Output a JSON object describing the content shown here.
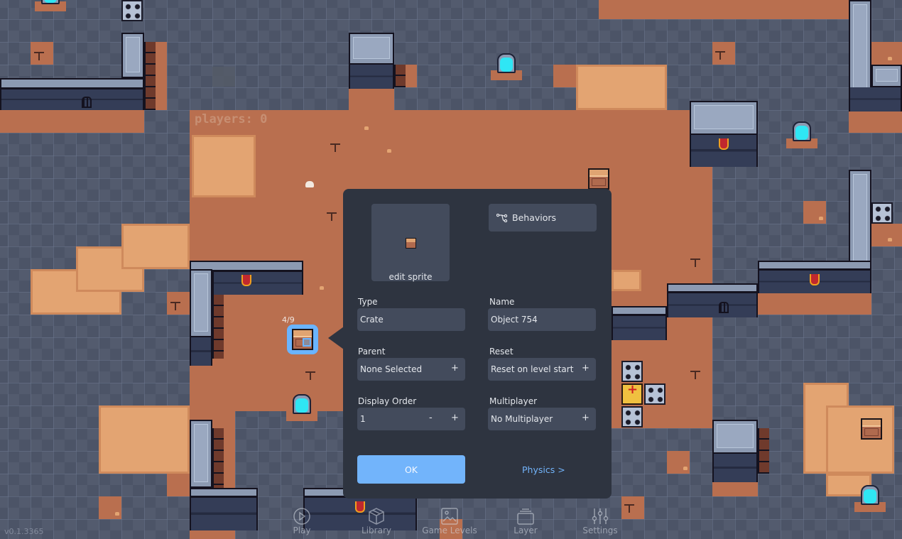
{
  "hud": {
    "players_label": "players: 0",
    "version": "v0.1.3365"
  },
  "selected_object": {
    "frame_counter": "4/9",
    "type": "crate"
  },
  "panel": {
    "edit_sprite_label": "edit sprite",
    "behaviors_label": "Behaviors",
    "fields": {
      "type": {
        "label": "Type",
        "value": "Crate"
      },
      "name": {
        "label": "Name",
        "value": "Object 754"
      },
      "parent": {
        "label": "Parent",
        "value": "None Selected",
        "plus": "+"
      },
      "reset": {
        "label": "Reset",
        "value": "Reset on level start",
        "plus": "+"
      },
      "display_order": {
        "label": "Display Order",
        "value": "1",
        "minus": "-",
        "plus": "+"
      },
      "multiplayer": {
        "label": "Multiplayer",
        "value": "No Multiplayer",
        "plus": "+"
      }
    },
    "ok_label": "OK",
    "physics_label": "Physics >"
  },
  "toolbar": {
    "items": [
      {
        "label": "Play",
        "icon": "play-icon"
      },
      {
        "label": "Library",
        "icon": "box-icon"
      },
      {
        "label": "Game Levels",
        "icon": "image-icon"
      },
      {
        "label": "Layer",
        "icon": "layers-icon"
      },
      {
        "label": "Settings",
        "icon": "sliders-icon"
      }
    ]
  },
  "colors": {
    "background": "#4c5467",
    "floor": "#b96f4f",
    "sand": "#e3a472",
    "panel": "#2e3440",
    "panel_field": "#434b5c",
    "accent": "#72b4fb",
    "selection": "#6ab4ff",
    "portal_glow": "#2fe6f4"
  }
}
